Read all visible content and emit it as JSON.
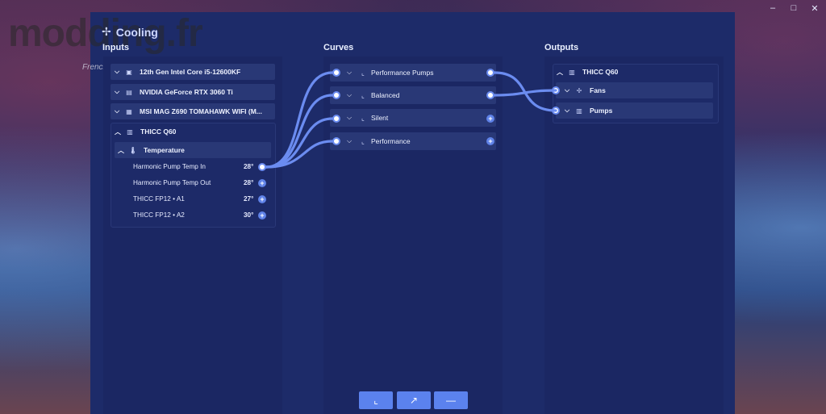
{
  "window": {
    "controls": {
      "minimize": "–",
      "maximize": "□",
      "close": "✕"
    }
  },
  "app": {
    "title": "Cooling",
    "title_icon": "fan-icon"
  },
  "watermark": {
    "brand": "modding.fr",
    "sub": "French"
  },
  "columns": {
    "inputs": "Inputs",
    "curves": "Curves",
    "outputs": "Outputs"
  },
  "inputs": {
    "devices": [
      {
        "label": "12th Gen Intel Core i5-12600KF",
        "icon": "cpu-icon"
      },
      {
        "label": "NVIDIA GeForce RTX 3060 Ti",
        "icon": "gpu-icon"
      },
      {
        "label": "MSI MAG Z690 TOMAHAWK WIFI (M...",
        "icon": "motherboard-icon"
      }
    ],
    "thicc": {
      "label": "THICC Q60",
      "icon": "aio-icon",
      "group_label": "Temperature",
      "group_icon": "thermometer-icon",
      "sensors": [
        {
          "label": "Harmonic Pump Temp In",
          "value": "28°",
          "connected": true
        },
        {
          "label": "Harmonic Pump Temp Out",
          "value": "28°",
          "connected": false
        },
        {
          "label": "THICC FP12 • A1",
          "value": "27°",
          "connected": false
        },
        {
          "label": "THICC FP12 • A2",
          "value": "30°",
          "connected": false
        }
      ]
    }
  },
  "curves": [
    {
      "label": "Performance Pumps",
      "out_connected": true
    },
    {
      "label": "Balanced",
      "out_connected": true
    },
    {
      "label": "Silent",
      "out_connected": false
    },
    {
      "label": "Performance",
      "out_connected": false
    }
  ],
  "outputs": {
    "device": {
      "label": "THICC Q60",
      "icon": "aio-icon"
    },
    "items": [
      {
        "label": "Fans",
        "icon": "fan-icon"
      },
      {
        "label": "Pumps",
        "icon": "pump-icon"
      }
    ]
  },
  "toolbar": {
    "buttons": [
      {
        "name": "add-curve-button",
        "glyph": "⛶"
      },
      {
        "name": "add-linear-button",
        "glyph": "↗"
      },
      {
        "name": "add-fixed-button",
        "glyph": "—"
      }
    ]
  },
  "colors": {
    "accent": "#5b82ee",
    "wire": "#6b8cf0",
    "panel": "#1b2763",
    "row": "#293876"
  }
}
